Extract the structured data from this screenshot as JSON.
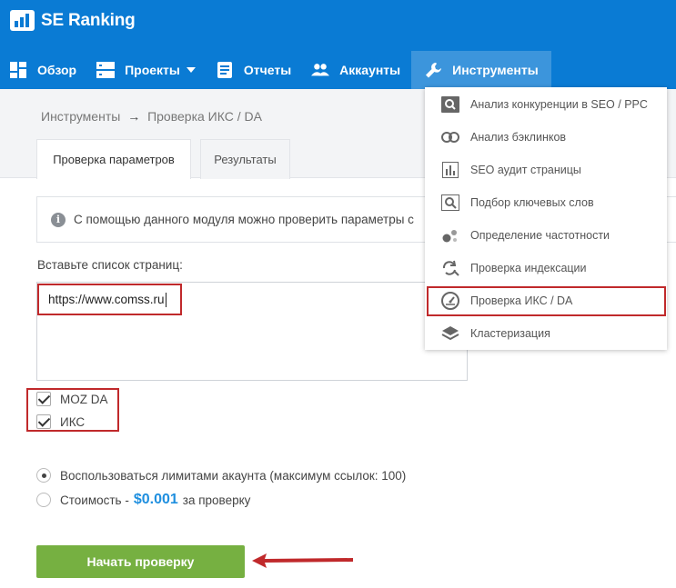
{
  "header": {
    "brand": "SE Ranking",
    "colors": {
      "bar": "#0a7bd4",
      "active": "#3c95dc"
    },
    "nav": [
      {
        "label": "Обзор",
        "icon": "dashboard-icon"
      },
      {
        "label": "Проекты",
        "icon": "projects-icon",
        "has_caret": true
      },
      {
        "label": "Отчеты",
        "icon": "report-icon"
      },
      {
        "label": "Аккаунты",
        "icon": "users-icon"
      },
      {
        "label": "Инструменты",
        "icon": "wrench-icon",
        "active": true
      }
    ]
  },
  "breadcrumb": {
    "parent": "Инструменты",
    "separator": "→",
    "current": "Проверка ИКС / DA"
  },
  "tabs": [
    {
      "label": "Проверка параметров",
      "active": true
    },
    {
      "label": "Результаты",
      "active": false
    }
  ],
  "info": {
    "icon": "info-icon",
    "text": "С помощью данного модуля можно проверить параметры с"
  },
  "urls": {
    "label": "Вставьте список страниц:",
    "value": "https://www.comss.ru"
  },
  "checks": [
    {
      "label": "MOZ DA",
      "checked": true
    },
    {
      "label": "ИКС",
      "checked": true
    }
  ],
  "options": {
    "limits_label": "Воспользоваться лимитами акаунта (максимум ссылок: 100)",
    "cost_prefix": "Стоимость -",
    "cost_value": "$0.001",
    "cost_suffix": "за проверку",
    "selected": "limits"
  },
  "start_button": {
    "label": "Начать проверку",
    "color": "#76b041"
  },
  "dropdown": {
    "items": [
      {
        "label": "Анализ конкуренции в SEO / PPC",
        "icon": "search-box-icon"
      },
      {
        "label": "Анализ бэклинков",
        "icon": "link-icon"
      },
      {
        "label": "SEO аудит страницы",
        "icon": "bar-chart-icon"
      },
      {
        "label": "Подбор ключевых слов",
        "icon": "keyword-search-icon"
      },
      {
        "label": "Определение частотности",
        "icon": "dots-icon"
      },
      {
        "label": "Проверка индексации",
        "icon": "refresh-search-icon"
      },
      {
        "label": "Проверка ИКС / DA",
        "icon": "gauge-icon",
        "highlighted": true
      },
      {
        "label": "Кластеризация",
        "icon": "layers-icon"
      }
    ]
  },
  "annotation_color": "#c0292b"
}
